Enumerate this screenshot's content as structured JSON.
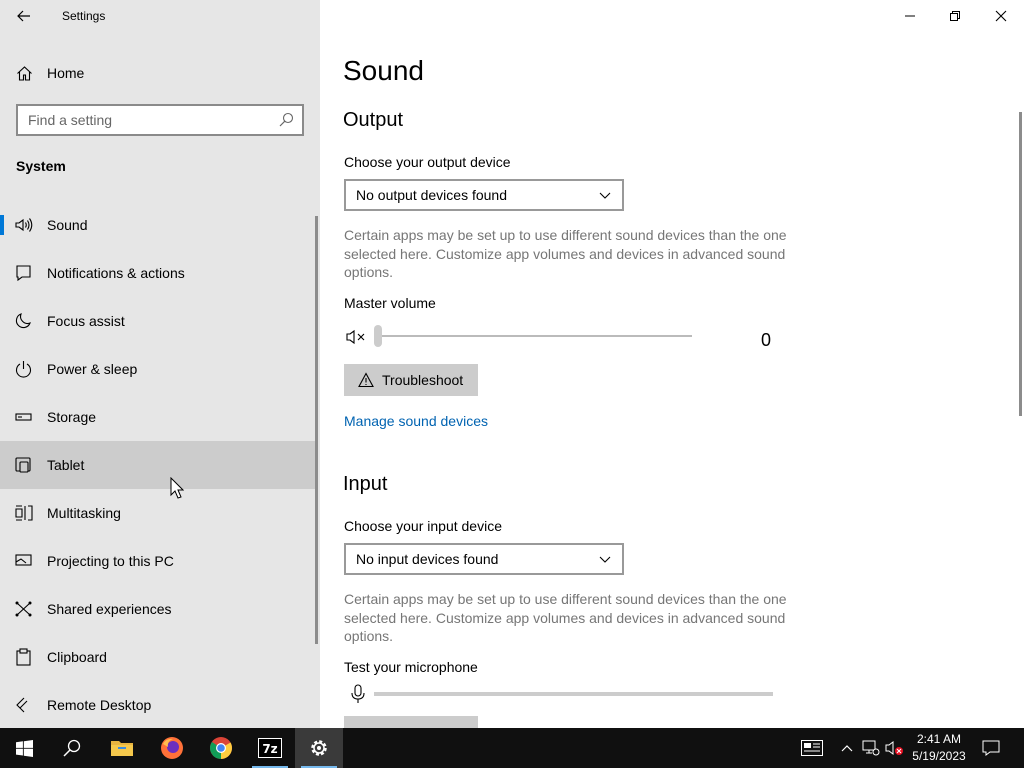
{
  "window": {
    "title": "Settings"
  },
  "sidebar": {
    "home_label": "Home",
    "search_placeholder": "Find a setting",
    "section_label": "System",
    "items": [
      {
        "label": "Sound",
        "icon": "speaker-icon",
        "selected": true
      },
      {
        "label": "Notifications & actions",
        "icon": "notification-icon"
      },
      {
        "label": "Focus assist",
        "icon": "moon-icon"
      },
      {
        "label": "Power & sleep",
        "icon": "power-icon"
      },
      {
        "label": "Storage",
        "icon": "storage-icon"
      },
      {
        "label": "Tablet",
        "icon": "tablet-icon",
        "hovered": true
      },
      {
        "label": "Multitasking",
        "icon": "multitasking-icon"
      },
      {
        "label": "Projecting to this PC",
        "icon": "projecting-icon"
      },
      {
        "label": "Shared experiences",
        "icon": "shared-icon"
      },
      {
        "label": "Clipboard",
        "icon": "clipboard-icon"
      },
      {
        "label": "Remote Desktop",
        "icon": "remote-desktop-icon"
      }
    ]
  },
  "main": {
    "title": "Sound",
    "output": {
      "heading": "Output",
      "device_label": "Choose your output device",
      "device_value": "No output devices found",
      "description": "Certain apps may be set up to use different sound devices than the one selected here. Customize app volumes and devices in advanced sound options.",
      "volume_label": "Master volume",
      "volume_value": "0",
      "troubleshoot_label": "Troubleshoot",
      "manage_link": "Manage sound devices"
    },
    "input": {
      "heading": "Input",
      "device_label": "Choose your input device",
      "device_value": "No input devices found",
      "description": "Certain apps may be set up to use different sound devices than the one selected here. Customize app volumes and devices in advanced sound options.",
      "test_label": "Test your microphone"
    }
  },
  "taskbar": {
    "time": "2:41 AM",
    "date": "5/19/2023",
    "apps": [
      "start-icon",
      "search-icon",
      "file-explorer-icon",
      "firefox-icon",
      "chrome-icon",
      "7zip-icon",
      "settings-icon"
    ]
  },
  "colors": {
    "accent": "#0078d7",
    "link": "#0063b1",
    "sidebar_bg": "#e6e6e6",
    "taskbar_bg": "#101010"
  }
}
